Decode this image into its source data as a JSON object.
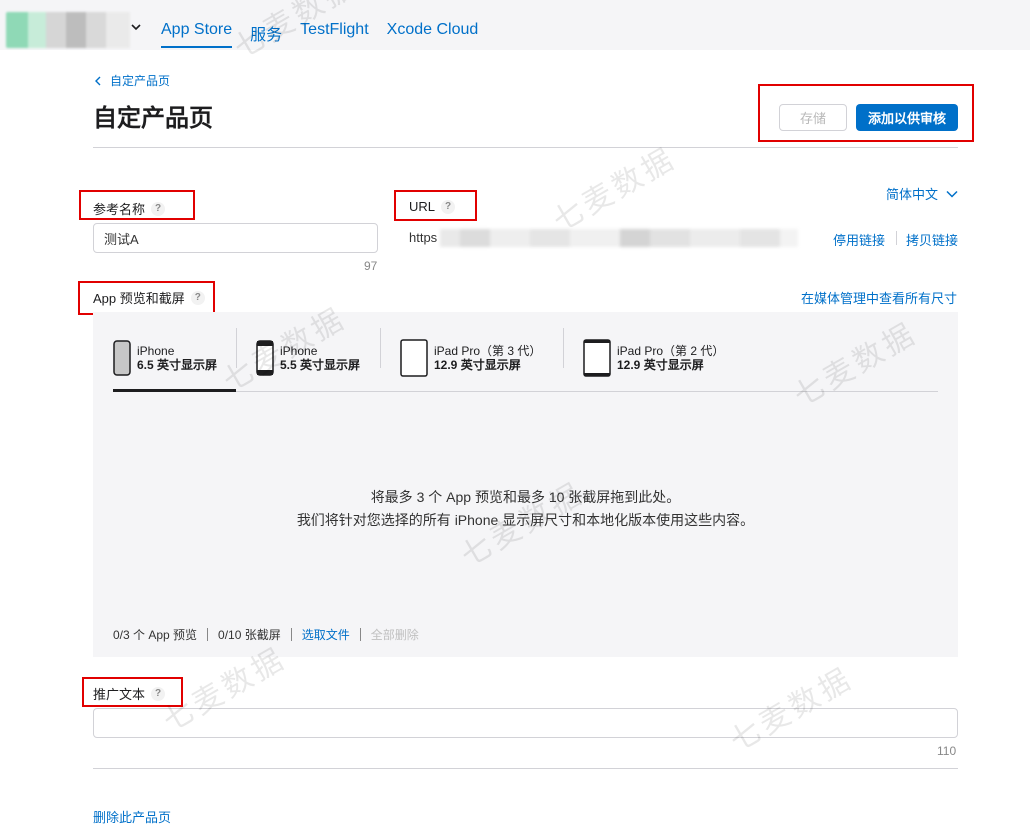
{
  "nav": {
    "items": [
      {
        "label": "App Store",
        "active": true
      },
      {
        "label": "服务",
        "active": false
      },
      {
        "label": "TestFlight",
        "active": false
      },
      {
        "label": "Xcode Cloud",
        "active": false
      }
    ]
  },
  "breadcrumb": {
    "label": "自定产品页"
  },
  "page_title": "自定产品页",
  "actions": {
    "save_label": "存储",
    "submit_label": "添加以供审核"
  },
  "language": {
    "selected": "简体中文"
  },
  "reference_name": {
    "label": "参考名称",
    "help": "?",
    "value": "测试A",
    "remaining": "97"
  },
  "url": {
    "label": "URL",
    "help": "?",
    "prefix": "https",
    "disable_link": "停用链接",
    "copy_link": "拷贝链接"
  },
  "media": {
    "label": "App 预览和截屏",
    "help": "?",
    "view_all_sizes": "在媒体管理中查看所有尺寸",
    "devices": [
      {
        "name": "iPhone",
        "size": "6.5 英寸显示屏",
        "active": true
      },
      {
        "name": "iPhone",
        "size": "5.5 英寸显示屏",
        "active": false
      },
      {
        "name": "iPad Pro（第 3 代）",
        "size": "12.9 英寸显示屏",
        "active": false
      },
      {
        "name": "iPad Pro（第 2 代）",
        "size": "12.9 英寸显示屏",
        "active": false
      }
    ],
    "drop_line1": "将最多 3 个 App 预览和最多 10 张截屏拖到此处。",
    "drop_line2": "我们将针对您选择的所有 iPhone 显示屏尺寸和本地化版本使用这些内容。",
    "preview_count": "0/3 个 App 预览",
    "screenshot_count": "0/10 张截屏",
    "choose_file": "选取文件",
    "delete_all": "全部删除"
  },
  "promo_text": {
    "label": "推广文本",
    "help": "?",
    "value": "",
    "remaining": "110"
  },
  "delete_page": "删除此产品页",
  "watermark": "七麦数据",
  "colors": {
    "accent": "#0070c9",
    "annotation_red": "#e10000"
  }
}
